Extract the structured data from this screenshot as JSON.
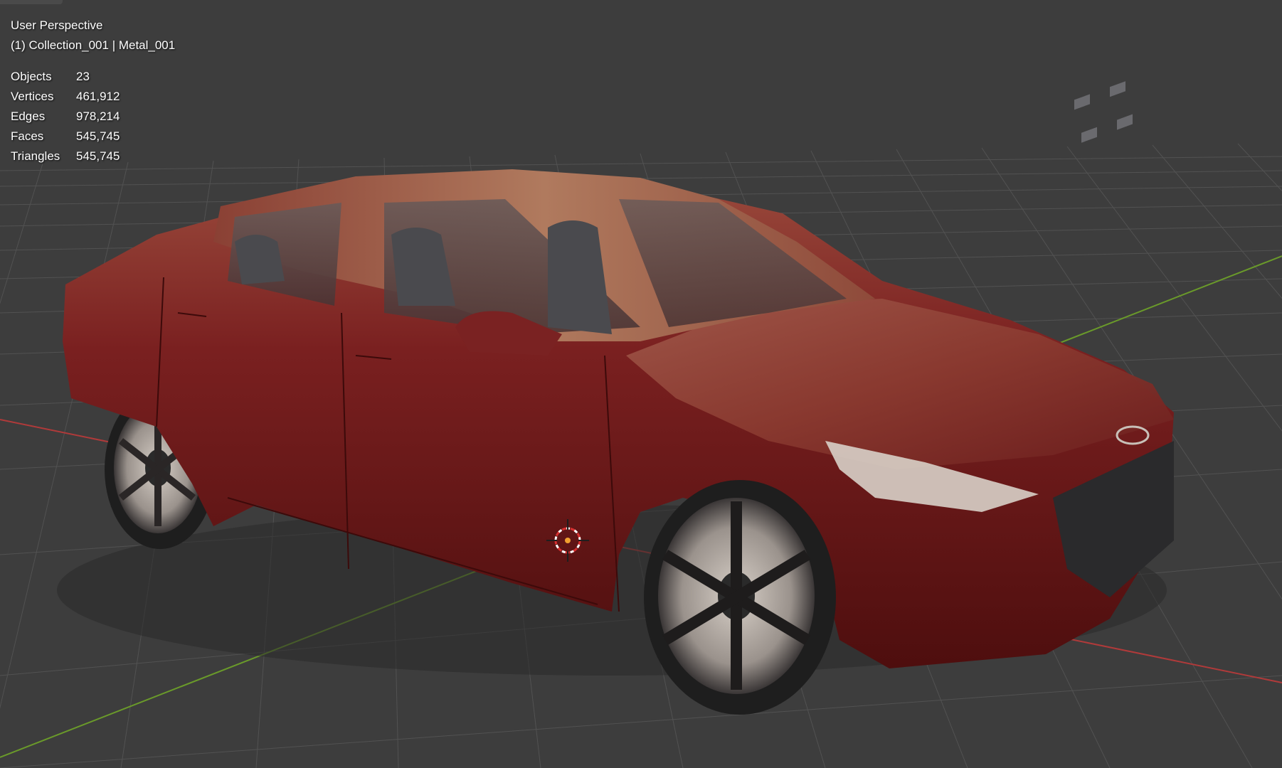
{
  "viewport": {
    "mode": "User Perspective",
    "context": "(1) Collection_001 | Metal_001",
    "background_color": "#3d3d3d",
    "grid_color": "#525252",
    "x_axis_color": "#b03a3a",
    "y_axis_color": "#6a9a2a"
  },
  "stats": [
    {
      "label": "Objects",
      "value": "23"
    },
    {
      "label": "Vertices",
      "value": "461,912"
    },
    {
      "label": "Edges",
      "value": "978,214"
    },
    {
      "label": "Faces",
      "value": "545,745"
    },
    {
      "label": "Triangles",
      "value": "545,745"
    }
  ],
  "model": {
    "body_color": "#6e1616",
    "icons": [
      "3d-cursor-icon",
      "origin-point-icon",
      "car-logo-icon"
    ]
  }
}
